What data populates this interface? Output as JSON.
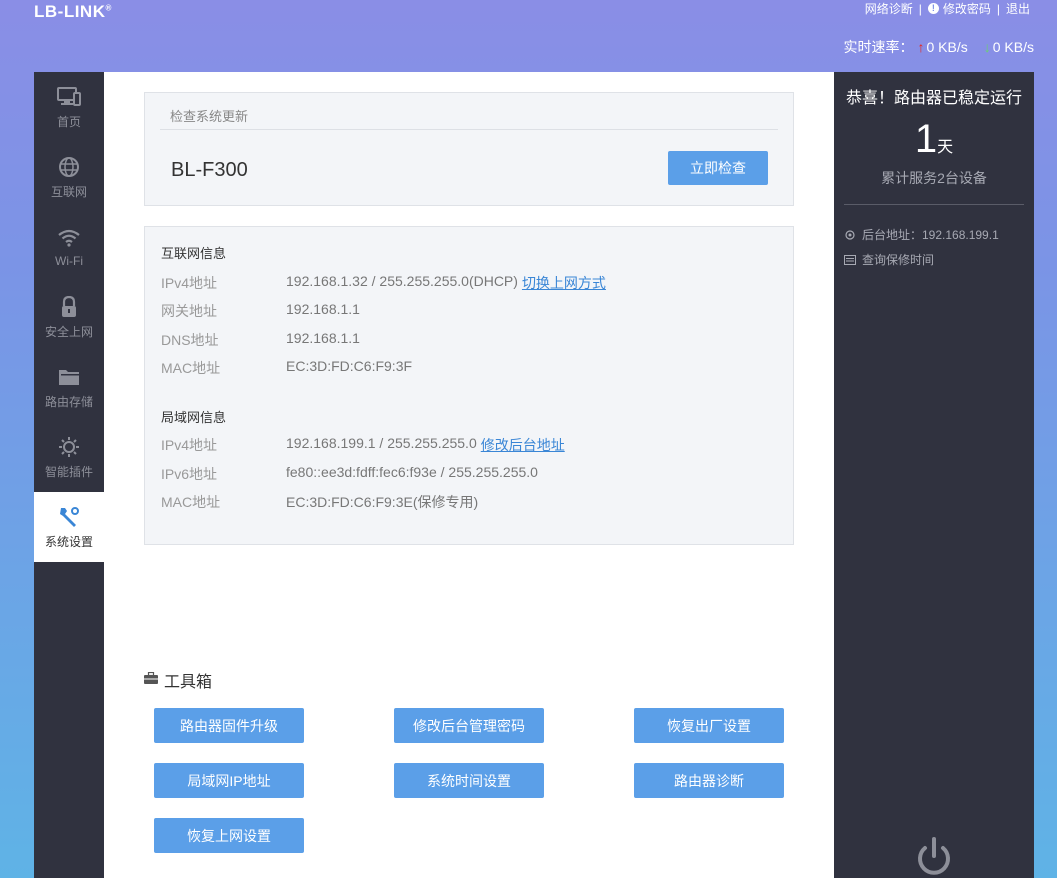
{
  "brand": {
    "logo": "LB-LINK",
    "reg": "®"
  },
  "header": {
    "links": [
      "网络诊断",
      "修改密码",
      "退出"
    ],
    "speed_label": "实时速率：",
    "up": "0 KB/s",
    "down": "0 KB/s",
    "up_arrow": "↑",
    "down_arrow": "↓"
  },
  "sidebar": {
    "items": [
      {
        "label": "首页",
        "icon": "monitor-icon"
      },
      {
        "label": "互联网",
        "icon": "globe-icon"
      },
      {
        "label": "Wi-Fi",
        "icon": "wifi-icon"
      },
      {
        "label": "安全上网",
        "icon": "lock-icon"
      },
      {
        "label": "路由存储",
        "icon": "folder-icon"
      },
      {
        "label": "智能插件",
        "icon": "plugin-icon"
      },
      {
        "label": "系统设置",
        "icon": "wrench-icon",
        "active": true
      }
    ]
  },
  "update": {
    "title": "检查系统更新",
    "model": "BL-F300",
    "button": "立即检查"
  },
  "internet": {
    "title": "互联网信息",
    "ipv4_label": "IPv4地址",
    "ipv4_value": "192.168.1.32 / 255.255.255.0(DHCP)",
    "ipv4_link": "切换上网方式",
    "gateway_label": "网关地址",
    "gateway_value": "192.168.1.1",
    "dns_label": "DNS地址",
    "dns_value": "192.168.1.1",
    "mac_label": "MAC地址",
    "mac_value": "EC:3D:FD:C6:F9:3F"
  },
  "lan": {
    "title": "局域网信息",
    "ipv4_label": "IPv4地址",
    "ipv4_value": "192.168.199.1 / 255.255.255.0",
    "ipv4_link": "修改后台地址",
    "ipv6_label": "IPv6地址",
    "ipv6_value": "fe80::ee3d:fdff:fec6:f93e / 255.255.255.0",
    "mac_label": "MAC地址",
    "mac_value": "EC:3D:FD:C6:F9:3E(保修专用)"
  },
  "toolbox": {
    "title": "工具箱",
    "buttons": [
      "路由器固件升级",
      "修改后台管理密码",
      "恢复出厂设置",
      "局域网IP地址",
      "系统时间设置",
      "路由器诊断",
      "恢复上网设置"
    ]
  },
  "status": {
    "congrats": "恭喜！路由器已稳定运行",
    "days": "1",
    "days_unit": "天",
    "served": "累计服务2台设备",
    "admin_addr": "后台地址：192.168.199.1",
    "warranty": "查询保修时间"
  },
  "colors": {
    "accent": "#5b9fe8",
    "sidebar_bg": "#30323f",
    "up_arrow": "#e8281e",
    "down_arrow": "#6ad36e"
  }
}
